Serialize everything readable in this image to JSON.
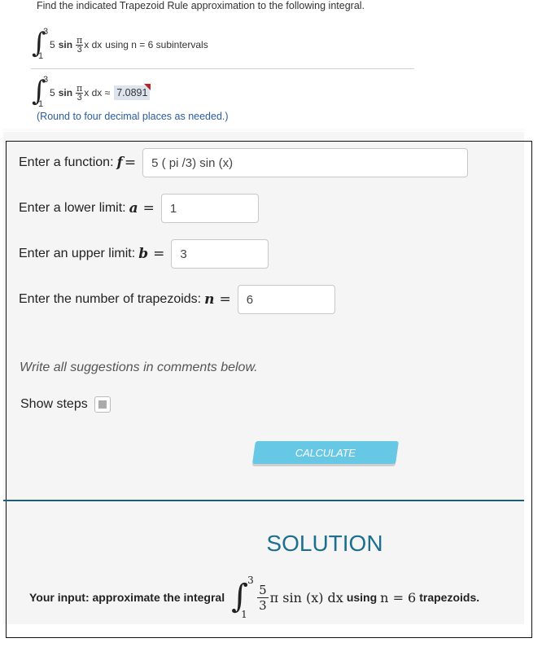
{
  "question": {
    "title": "Find the indicated Trapezoid Rule approximation to the following integral.",
    "integral": {
      "lower": "1",
      "upper": "3",
      "coef": "5",
      "func": "sin",
      "frac_num": "π",
      "frac_den": "3",
      "var_tail": "x dx",
      "suffix": "using n = 6 subintervals"
    },
    "answer_line": {
      "approx_symbol": "x dx ≈",
      "answer_value": "7.0891"
    },
    "round_note": "(Round to four decimal places as needed.)"
  },
  "calculator": {
    "function_label": "Enter a function:",
    "function_var": "f",
    "function_value": "5 ( pi /3) sin (x)",
    "lower_label": "Enter a lower limit:",
    "lower_var": "a",
    "lower_value": "1",
    "upper_label": "Enter an upper limit:",
    "upper_var": "b",
    "upper_value": "3",
    "n_label": "Enter the number of trapezoids:",
    "n_var": "n",
    "n_value": "6",
    "equals": "=",
    "suggestion_note": "Write all suggestions in comments below.",
    "show_steps_label": "Show steps",
    "show_steps_checked": false,
    "calculate_label": "CALCULATE"
  },
  "solution": {
    "title": "SOLUTION",
    "intro": "Your input: approximate the integral",
    "upper": "3",
    "lower": "1",
    "frac_num": "5",
    "frac_den": "3",
    "expr": "π sin (x) dx",
    "using": "using",
    "n_expr": "n = 6",
    "suffix": "trapezoids."
  },
  "colors": {
    "accent_blue": "#1d6f8f",
    "button": "#66c8e4",
    "answer_highlight": "#dde4ee",
    "note_blue": "#2a5c9e",
    "flag_red": "#c0202a"
  }
}
